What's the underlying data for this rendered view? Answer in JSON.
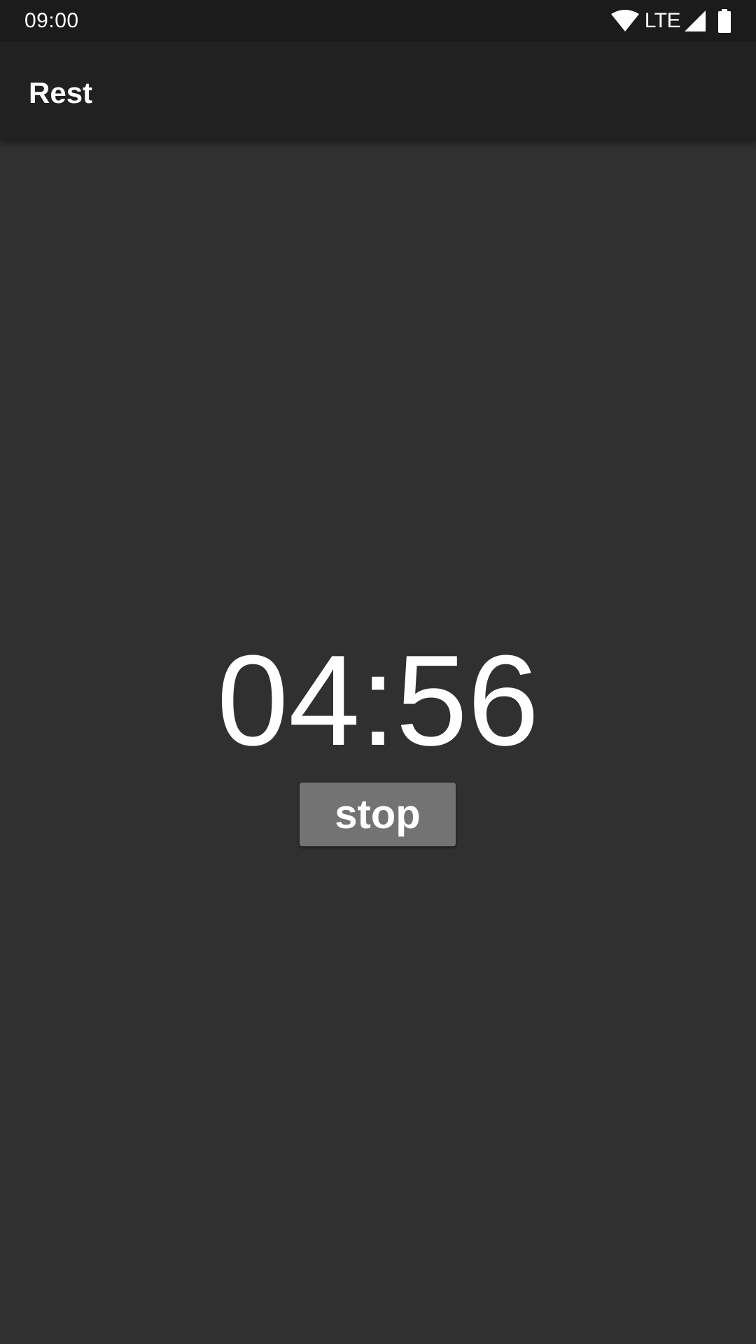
{
  "status_bar": {
    "time": "09:00",
    "network_label": "LTE",
    "icons": [
      "wifi-icon",
      "signal-icon",
      "battery-icon"
    ]
  },
  "app_bar": {
    "title": "Rest"
  },
  "timer": {
    "display": "04:56"
  },
  "controls": {
    "stop_label": "stop"
  },
  "colors": {
    "background": "#303030",
    "app_bar": "#212121",
    "status_bar": "#1b1b1b",
    "button": "#737373",
    "text": "#ffffff"
  }
}
